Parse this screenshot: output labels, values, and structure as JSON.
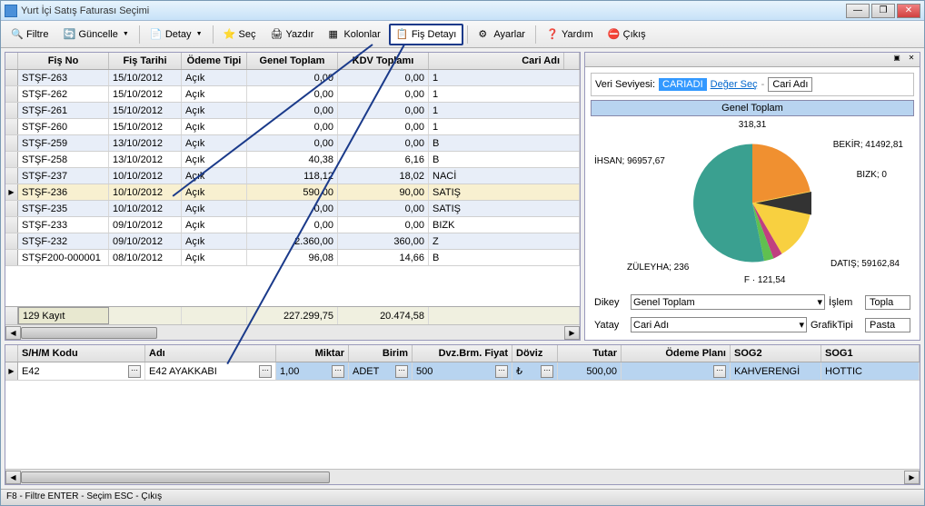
{
  "window": {
    "title": "Yurt İçi Satış Faturası Seçimi"
  },
  "toolbar": {
    "filter": "Filtre",
    "update": "Güncelle",
    "detail": "Detay",
    "select": "Seç",
    "print": "Yazdır",
    "columns": "Kolonlar",
    "slip_detail": "Fiş Detayı",
    "settings": "Ayarlar",
    "help": "Yardım",
    "exit": "Çıkış"
  },
  "grid": {
    "headers": {
      "fis_no": "Fiş No",
      "fis_tarihi": "Fiş Tarihi",
      "odeme_tipi": "Ödeme Tipi",
      "genel_toplam": "Genel Toplam",
      "kdv_toplami": "KDV Toplamı",
      "cari_adi": "Cari Adı"
    },
    "rows": [
      {
        "fis_no": "STŞF-263",
        "tarih": "15/10/2012",
        "odeme": "Açık",
        "toplam": "0,00",
        "kdv": "0,00",
        "cari": "1"
      },
      {
        "fis_no": "STŞF-262",
        "tarih": "15/10/2012",
        "odeme": "Açık",
        "toplam": "0,00",
        "kdv": "0,00",
        "cari": "1"
      },
      {
        "fis_no": "STŞF-261",
        "tarih": "15/10/2012",
        "odeme": "Açık",
        "toplam": "0,00",
        "kdv": "0,00",
        "cari": "1"
      },
      {
        "fis_no": "STŞF-260",
        "tarih": "15/10/2012",
        "odeme": "Açık",
        "toplam": "0,00",
        "kdv": "0,00",
        "cari": "1"
      },
      {
        "fis_no": "STŞF-259",
        "tarih": "13/10/2012",
        "odeme": "Açık",
        "toplam": "0,00",
        "kdv": "0,00",
        "cari": "B"
      },
      {
        "fis_no": "STŞF-258",
        "tarih": "13/10/2012",
        "odeme": "Açık",
        "toplam": "40,38",
        "kdv": "6,16",
        "cari": "B"
      },
      {
        "fis_no": "STŞF-237",
        "tarih": "10/10/2012",
        "odeme": "Açık",
        "toplam": "118,12",
        "kdv": "18,02",
        "cari": "NACİ"
      },
      {
        "fis_no": "STŞF-236",
        "tarih": "10/10/2012",
        "odeme": "Açık",
        "toplam": "590,00",
        "kdv": "90,00",
        "cari": "SATIŞ",
        "selected": true
      },
      {
        "fis_no": "STŞF-235",
        "tarih": "10/10/2012",
        "odeme": "Açık",
        "toplam": "0,00",
        "kdv": "0,00",
        "cari": "SATIŞ"
      },
      {
        "fis_no": "STŞF-233",
        "tarih": "09/10/2012",
        "odeme": "Açık",
        "toplam": "0,00",
        "kdv": "0,00",
        "cari": "BIZK"
      },
      {
        "fis_no": "STŞF-232",
        "tarih": "09/10/2012",
        "odeme": "Açık",
        "toplam": "2.360,00",
        "kdv": "360,00",
        "cari": "Z"
      },
      {
        "fis_no": "STŞF200-000001",
        "tarih": "08/10/2012",
        "odeme": "Açık",
        "toplam": "96,08",
        "kdv": "14,66",
        "cari": "B"
      }
    ],
    "footer": {
      "count": "129 Kayıt",
      "toplam": "227.299,75",
      "kdv": "20.474,58"
    }
  },
  "side": {
    "level_label": "Veri Seviyesi:",
    "level_value": "CARIADI",
    "level_link": "Değer Seç",
    "level_text": "Cari Adı",
    "chart_title": "Genel Toplam",
    "dikey_label": "Dikey",
    "dikey_value": "Genel Toplam",
    "yatay_label": "Yatay",
    "yatay_value": "Cari Adı",
    "islem_label": "İşlem",
    "islem_value": "Topla",
    "grafik_label": "GrafikTipi",
    "grafik_value": "Pasta"
  },
  "chart_data": {
    "type": "pie",
    "title": "Genel Toplam",
    "series": [
      {
        "name": "İHSAN",
        "value": 96957.67,
        "color": "#3aa090"
      },
      {
        "name": "BEKİR",
        "value": 41492.81,
        "color": "#f09030"
      },
      {
        "name": "BIZK",
        "value": 0,
        "color": "#ffe060"
      },
      {
        "name": "DATIŞ",
        "value": 59162.84,
        "color": "#f8d040"
      },
      {
        "name": "F",
        "value": 121.54,
        "color": "#c04080"
      },
      {
        "name": "ZÜLEYHA",
        "value": 236,
        "color": "#60c050"
      }
    ],
    "labels": [
      "İHSAN; 96957,67",
      "BEKİR; 41492,81",
      "BIZK; 0",
      "DATIŞ; 59162,84",
      "F · 121,54",
      "ZÜLEYHA; 236"
    ],
    "top_crop_label": "318,31"
  },
  "detail": {
    "headers": {
      "shm": "S/H/M Kodu",
      "adi": "Adı",
      "miktar": "Miktar",
      "birim": "Birim",
      "dvz_fiyat": "Dvz.Brm. Fiyat",
      "doviz": "Döviz",
      "tutar": "Tutar",
      "odeme_plani": "Ödeme Planı",
      "sog2": "SOG2",
      "sog1": "SOG1"
    },
    "row": {
      "shm": "E42",
      "adi": "E42 AYAKKABI",
      "miktar": "1,00",
      "birim": "ADET",
      "dvz_fiyat": "500",
      "doviz": "₺",
      "tutar": "500,00",
      "odeme_plani": "",
      "sog2": "KAHVERENGİ",
      "sog1": "HOTTIC"
    }
  },
  "statusbar": "F8 - Filtre ENTER - Seçim ESC - Çıkış"
}
